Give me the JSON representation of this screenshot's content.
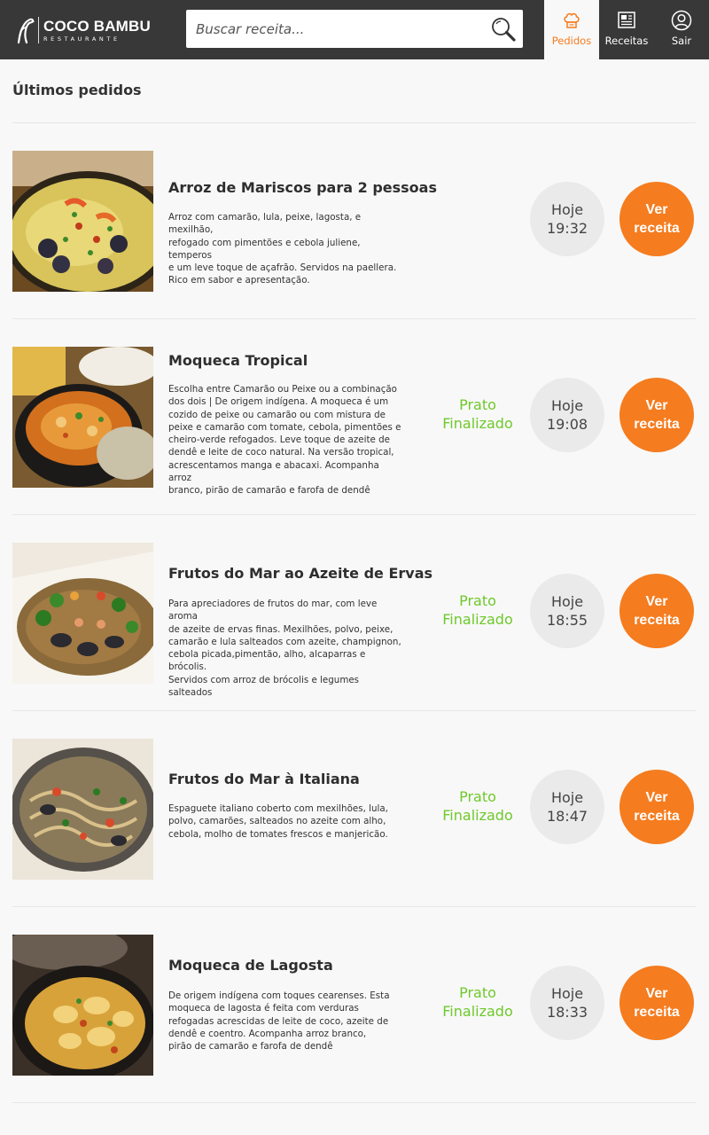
{
  "header": {
    "logo": {
      "name": "COCO BAMBU",
      "sub": "RESTAURANTE"
    },
    "search": {
      "placeholder": "Buscar receita...",
      "value": ""
    },
    "tabs": [
      {
        "label": "Pedidos",
        "icon": "chef-hat-icon",
        "active": true
      },
      {
        "label": "Receitas",
        "icon": "newspaper-icon",
        "active": false
      },
      {
        "label": "Sair",
        "icon": "user-icon",
        "active": false
      }
    ]
  },
  "main": {
    "title": "Últimos pedidos",
    "orders": [
      {
        "title": "Arroz de Mariscos para 2 pessoas",
        "description": "Arroz com camarão, lula, peixe, lagosta, e mexilhão,\nrefogado com pimentões e cebola juliene, temperos\ne um leve toque de açafrão. Servidos na paellera.\nRico em sabor e apresentação.",
        "status": "",
        "day": "Hoje",
        "time": "19:32",
        "button": [
          "Ver",
          "receita"
        ]
      },
      {
        "title": "Moqueca Tropical",
        "description": "Escolha entre Camarão ou Peixe ou a combinação\ndos dois | De origem indígena. A moqueca é um\ncozido de peixe ou camarão ou com mistura de\npeixe e camarão com tomate, cebola, pimentões e\ncheiro-verde refogados. Leve toque de azeite de\ndendê e leite de coco natural. Na versão tropical,\nacrescentamos manga e abacaxi. Acompanha arroz\nbranco, pirão de camarão e farofa de dendê",
        "status": [
          "Prato",
          "Finalizado"
        ],
        "day": "Hoje",
        "time": "19:08",
        "button": [
          "Ver",
          "receita"
        ]
      },
      {
        "title": "Frutos do Mar ao Azeite de Ervas",
        "description": "Para apreciadores de frutos do mar, com leve aroma\nde azeite de ervas finas. Mexilhões, polvo, peixe,\ncamarão e lula salteados com azeite, champignon,\ncebola picada,pimentão, alho, alcaparras e brócolis.\nServidos com arroz de brócolis e legumes salteados",
        "status": [
          "Prato",
          "Finalizado"
        ],
        "day": "Hoje",
        "time": "18:55",
        "button": [
          "Ver",
          "receita"
        ]
      },
      {
        "title": "Frutos do Mar à Italiana",
        "description": "Espaguete italiano coberto com mexilhões, lula,\npolvo, camarões, salteados no azeite com alho,\ncebola, molho de tomates frescos e manjericão.",
        "status": [
          "Prato",
          "Finalizado"
        ],
        "day": "Hoje",
        "time": "18:47",
        "button": [
          "Ver",
          "receita"
        ]
      },
      {
        "title": "Moqueca de Lagosta",
        "description": "De origem indígena com toques cearenses. Esta\nmoqueca de lagosta é feita com verduras\n refogadas acrescidas de leite de coco, azeite de\ndendê e coentro. Acompanha arroz branco,\n pirão de camarão e farofa de dendê",
        "status": [
          "Prato",
          "Finalizado"
        ],
        "day": "Hoje",
        "time": "18:33",
        "button": [
          "Ver",
          "receita"
        ]
      }
    ]
  },
  "colors": {
    "accent": "#f57c1f",
    "status": "#6ec92a",
    "topbar": "#383838"
  }
}
